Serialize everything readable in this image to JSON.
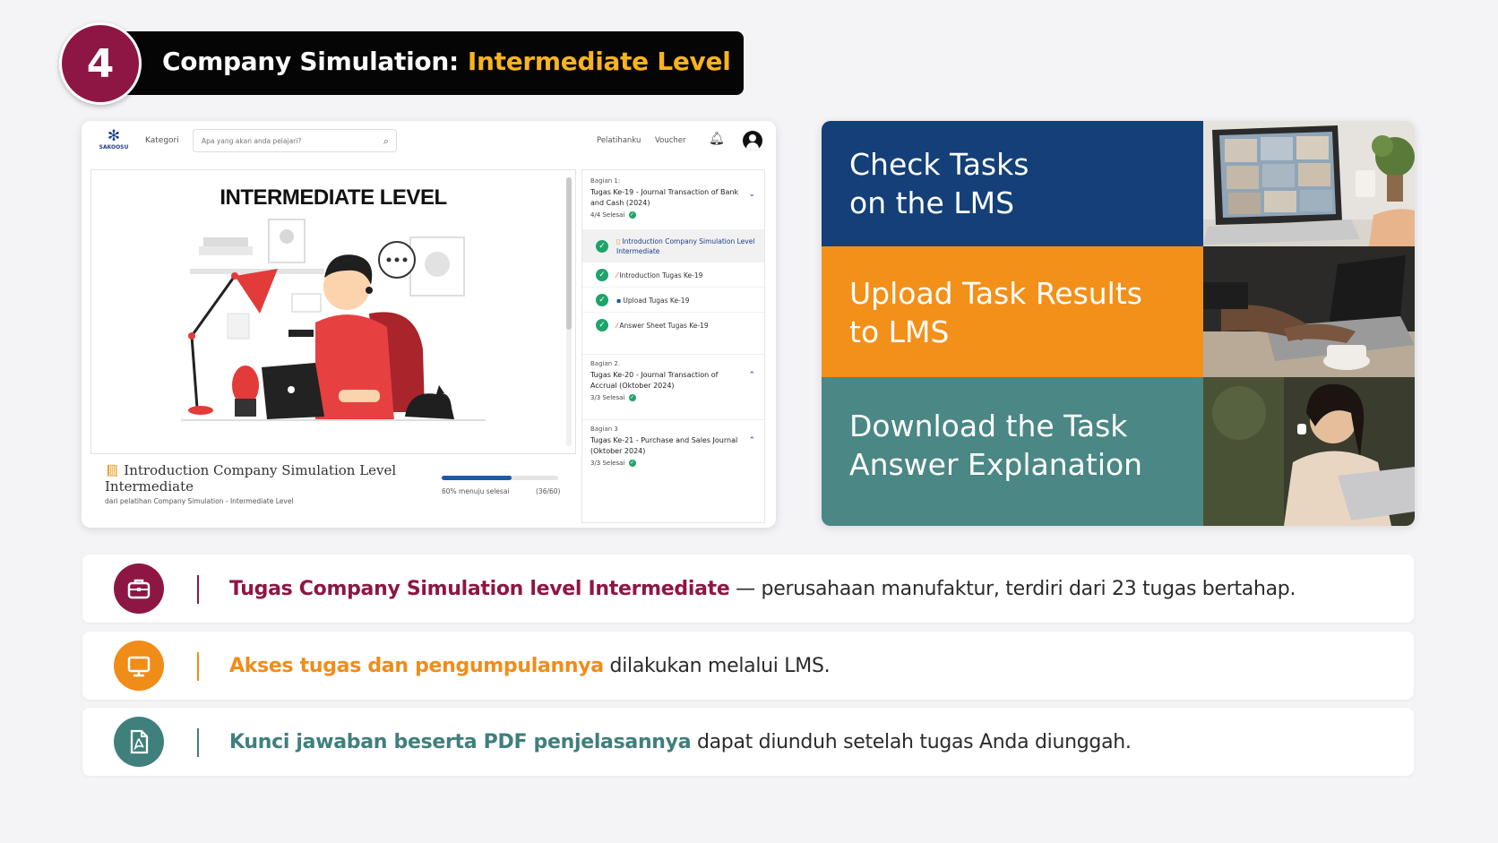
{
  "header": {
    "number": "4",
    "title": "Company Simulation:",
    "highlight": "Intermediate Level"
  },
  "lms": {
    "logo_text": "SAKOOSU",
    "nav": {
      "kategori": "Kategori",
      "search_placeholder": "Apa yang akan anda pelajari?",
      "pelatihanku": "Pelatihanku",
      "voucher": "Voucher"
    },
    "main_heading": "INTERMEDIATE LEVEL",
    "footer": {
      "title": "Introduction Company Simulation Level Intermediate",
      "subtitle": "dari pelatihan Company Simulation - Intermediate Level",
      "progress_text": "60% menuju selesai",
      "progress_count": "(36/60)",
      "progress_fraction": 0.6
    },
    "sections": [
      {
        "label": "Bagian 1:",
        "title": "Tugas Ke-19 - Journal Transaction of Bank and Cash (2024)",
        "done": "4/4 Selesai",
        "items": [
          "Introduction Company Simulation Level Intermediate",
          "Introduction Tugas Ke-19",
          "Upload Tugas Ke-19",
          "Answer Sheet Tugas Ke-19"
        ]
      },
      {
        "label": "Bagian 2.",
        "title": "Tugas Ke-20 - Journal Transaction of Accrual (Oktober 2024)",
        "done": "3/3 Selesai"
      },
      {
        "label": "Bagian 3",
        "title": "Tugas Ke-21 - Purchase and Sales Journal (Oktober 2024)",
        "done": "3/3 Selesai"
      }
    ]
  },
  "steps": [
    {
      "label": "Check Tasks\non the LMS",
      "color": "#143f78"
    },
    {
      "label": "Upload Task Results\nto LMS",
      "color": "#f39019"
    },
    {
      "label": "Download the Task\nAnswer Explanation",
      "color": "#4a8785"
    }
  ],
  "rows": [
    {
      "icon": "briefcase-icon",
      "color": "#8e1645",
      "bold": "Tugas Company Simulation level Intermediate",
      "rest": " — perusahaan manufaktur, terdiri dari 23 tugas bertahap."
    },
    {
      "icon": "monitor-icon",
      "color": "#f08c18",
      "bold": "Akses tugas dan pengumpulannya",
      "rest": " dilakukan melalui LMS."
    },
    {
      "icon": "pdf-document-icon",
      "color": "#3f7f7c",
      "bold": "Kunci jawaban beserta PDF penjelasannya",
      "rest": " dapat diunduh setelah tugas Anda diunggah."
    }
  ]
}
